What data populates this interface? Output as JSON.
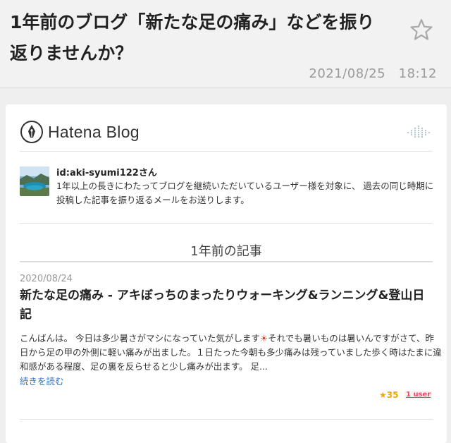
{
  "email": {
    "subject": "1年前のブログ「新たな足の痛み」などを振り返りませんか？",
    "date": "2021/08/25　18:12"
  },
  "brand": {
    "name": "Hatena Blog"
  },
  "recipient": {
    "username": "id:aki-syumi122さん",
    "intro": "1年以上の長きにわたってブログを継続いただいているユーザー様を対象に、 過去の同じ時期に投稿した記事を振り返るメールをお送りします。"
  },
  "section": {
    "title": "1年前の記事"
  },
  "post": {
    "date": "2020/08/24",
    "title": "新たな足の痛み - アキぼっちのまったりウォーキング&ランニング&登山日記",
    "excerpt_part1": "こんばんは。 今日は多少暑さがマシになっていた気がします",
    "sun_icon": "☀",
    "excerpt_part2": "それでも暑いものは暑いんですがさて、昨日から足の甲の外側に軽い痛みが出ました。１日たった今朝も多少痛みは残っていました歩く時はたまに違和感がある程度、足の裏を反らせると少し痛みが出ます。 足...",
    "read_more": "続きを読む",
    "stars": "★35",
    "users": "1 user"
  },
  "icons": {
    "favorite": "star-outline-icon",
    "logo": "fountain-pen-nib-icon",
    "decoration": "dotted-diamond-icon"
  },
  "colors": {
    "link": "#2a73c9",
    "star": "#f0a30a",
    "users": "#ff4166",
    "sun": "#e03b1c"
  }
}
